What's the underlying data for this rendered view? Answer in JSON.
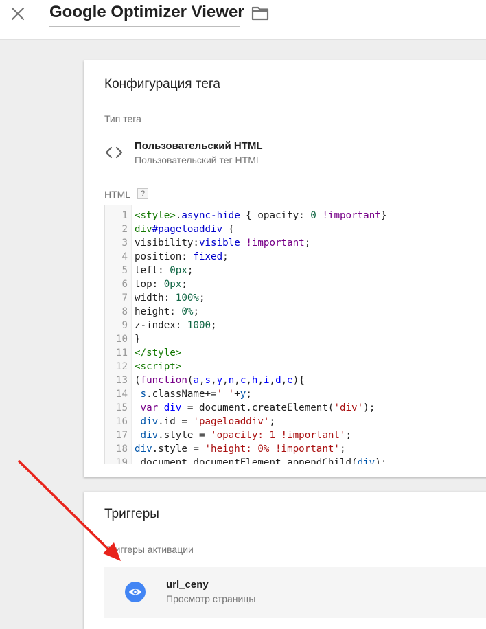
{
  "header": {
    "title": "Google Optimizer Viewer",
    "close_icon": "close-icon",
    "folder_icon": "folder-icon"
  },
  "config": {
    "title": "Конфигурация тега",
    "tag_type_label": "Тип тега",
    "tag_type_name": "Пользовательский HTML",
    "tag_type_desc": "Пользовательский тег HTML",
    "html_label": "HTML",
    "help": "?",
    "code_lines": [
      [
        [
          "tk-tag",
          "<style>"
        ],
        [
          "",
          "."
        ],
        [
          "tk-att",
          "async-hide"
        ],
        [
          "",
          " { opacity: "
        ],
        [
          "tk-num",
          "0"
        ],
        [
          "",
          " "
        ],
        [
          "tk-kw",
          "!important"
        ],
        [
          "",
          "}"
        ]
      ],
      [
        [
          "tk-tag",
          "div"
        ],
        [
          "tk-att",
          "#pageloaddiv"
        ],
        [
          "",
          " {"
        ]
      ],
      [
        [
          "",
          "visibility:"
        ],
        [
          "tk-att",
          "visible"
        ],
        [
          "",
          " "
        ],
        [
          "tk-kw",
          "!important"
        ],
        [
          "",
          ";"
        ]
      ],
      [
        [
          "",
          "position: "
        ],
        [
          "tk-att",
          "fixed"
        ],
        [
          "",
          ";"
        ]
      ],
      [
        [
          "",
          "left: "
        ],
        [
          "tk-num",
          "0px"
        ],
        [
          "",
          ";"
        ]
      ],
      [
        [
          "",
          "top: "
        ],
        [
          "tk-num",
          "0px"
        ],
        [
          "",
          ";"
        ]
      ],
      [
        [
          "",
          "width: "
        ],
        [
          "tk-num",
          "100%"
        ],
        [
          "",
          ";"
        ]
      ],
      [
        [
          "",
          "height: "
        ],
        [
          "tk-num",
          "0%"
        ],
        [
          "",
          ";"
        ]
      ],
      [
        [
          "",
          "z-index: "
        ],
        [
          "tk-num",
          "1000"
        ],
        [
          "",
          ";"
        ]
      ],
      [
        [
          "",
          "}"
        ]
      ],
      [
        [
          "tk-tag",
          "</style>"
        ]
      ],
      [
        [
          "tk-tag",
          "<script>"
        ]
      ],
      [
        [
          "",
          "("
        ],
        [
          "tk-kw",
          "function"
        ],
        [
          "",
          "("
        ],
        [
          "tk-def",
          "a"
        ],
        [
          "",
          ","
        ],
        [
          "tk-def",
          "s"
        ],
        [
          "",
          ","
        ],
        [
          "tk-def",
          "y"
        ],
        [
          "",
          ","
        ],
        [
          "tk-def",
          "n"
        ],
        [
          "",
          ","
        ],
        [
          "tk-def",
          "c"
        ],
        [
          "",
          ","
        ],
        [
          "tk-def",
          "h"
        ],
        [
          "",
          ","
        ],
        [
          "tk-def",
          "i"
        ],
        [
          "",
          ","
        ],
        [
          "tk-def",
          "d"
        ],
        [
          "",
          ","
        ],
        [
          "tk-def",
          "e"
        ],
        [
          "",
          "){"
        ]
      ],
      [
        [
          "",
          " "
        ],
        [
          "tk-var",
          "s"
        ],
        [
          "",
          ".className+="
        ],
        [
          "tk-str",
          "' '"
        ],
        [
          "",
          "+"
        ],
        [
          "tk-var",
          "y"
        ],
        [
          "",
          ";"
        ]
      ],
      [
        [
          "",
          " "
        ],
        [
          "tk-kw",
          "var"
        ],
        [
          "",
          " "
        ],
        [
          "tk-def",
          "div"
        ],
        [
          "",
          " = document.createElement("
        ],
        [
          "tk-str",
          "'div'"
        ],
        [
          "",
          ");"
        ]
      ],
      [
        [
          "",
          " "
        ],
        [
          "tk-var",
          "div"
        ],
        [
          "",
          ".id = "
        ],
        [
          "tk-str",
          "'pageloaddiv'"
        ],
        [
          "",
          ";"
        ]
      ],
      [
        [
          "",
          " "
        ],
        [
          "tk-var",
          "div"
        ],
        [
          "",
          ".style = "
        ],
        [
          "tk-str",
          "'opacity: 1 !important'"
        ],
        [
          "",
          ";"
        ]
      ],
      [
        [
          "tk-var",
          "div"
        ],
        [
          "",
          ".style = "
        ],
        [
          "tk-str",
          "'height: 0% !important'"
        ],
        [
          "",
          ";"
        ]
      ],
      [
        [
          "",
          " document.documentElement.appendChild("
        ],
        [
          "tk-var",
          "div"
        ],
        [
          "",
          ");"
        ]
      ]
    ]
  },
  "triggers": {
    "title": "Триггеры",
    "activation_label": "Триггеры активации",
    "item": {
      "name": "url_ceny",
      "type": "Просмотр страницы",
      "icon": "eye-icon",
      "icon_bg": "#4285f4"
    }
  },
  "annotation": {
    "arrow_color": "#e8231b"
  }
}
